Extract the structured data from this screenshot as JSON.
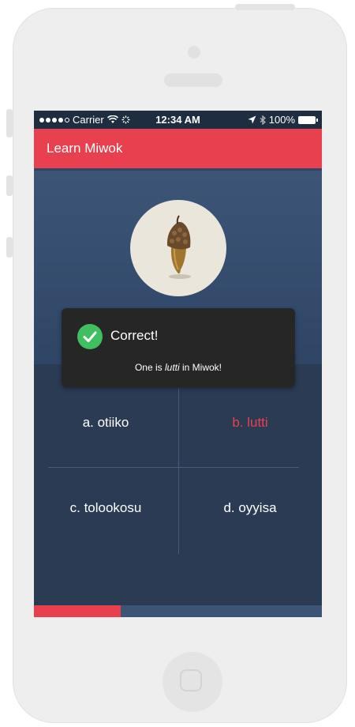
{
  "status_bar": {
    "carrier": "Carrier",
    "time": "12:34 AM",
    "battery": "100%"
  },
  "app_bar": {
    "title": "Learn Miwok"
  },
  "image": {
    "icon": "acorn-icon"
  },
  "toast": {
    "heading": "Correct!",
    "message_before": "One is ",
    "message_word": "lutti",
    "message_after": " in Miwok!",
    "icon": "check-circle-icon"
  },
  "answers": [
    {
      "label": "a. otiiko",
      "correct": false
    },
    {
      "label": "b. lutti",
      "correct": true
    },
    {
      "label": "c. tolookosu",
      "correct": false
    },
    {
      "label": "d. oyyisa",
      "correct": false
    }
  ],
  "progress": {
    "fraction": 0.3
  },
  "colors": {
    "accent": "#e8404f",
    "background": "#2b3b54",
    "toast": "#262626",
    "success": "#3fbf5f"
  }
}
